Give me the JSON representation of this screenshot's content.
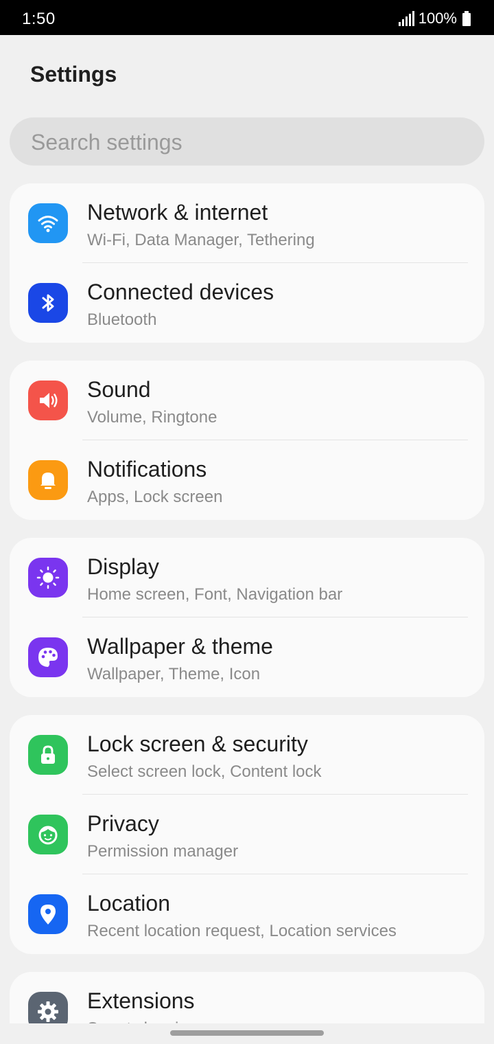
{
  "status_bar": {
    "time": "1:50",
    "battery": "100%"
  },
  "header": {
    "title": "Settings"
  },
  "search": {
    "placeholder": "Search settings"
  },
  "sections": [
    {
      "items": [
        {
          "title": "Network & internet",
          "subtitle": "Wi-Fi, Data Manager, Tethering",
          "icon": "wifi-icon",
          "color": "#2196f3"
        },
        {
          "title": "Connected devices",
          "subtitle": "Bluetooth",
          "icon": "bluetooth-icon",
          "color": "#1a47e6"
        }
      ]
    },
    {
      "items": [
        {
          "title": "Sound",
          "subtitle": "Volume, Ringtone",
          "icon": "speaker-icon",
          "color": "#f4544a"
        },
        {
          "title": "Notifications",
          "subtitle": "Apps, Lock screen",
          "icon": "bell-icon",
          "color": "#fb9a12"
        }
      ]
    },
    {
      "items": [
        {
          "title": "Display",
          "subtitle": "Home screen, Font, Navigation bar",
          "icon": "sun-icon",
          "color": "#7a35ef"
        },
        {
          "title": "Wallpaper & theme",
          "subtitle": "Wallpaper, Theme, Icon",
          "icon": "palette-icon",
          "color": "#7a35ef"
        }
      ]
    },
    {
      "items": [
        {
          "title": "Lock screen & security",
          "subtitle": "Select screen lock, Content lock",
          "icon": "lock-icon",
          "color": "#2fc45c"
        },
        {
          "title": "Privacy",
          "subtitle": "Permission manager",
          "icon": "face-icon",
          "color": "#2fc45c"
        },
        {
          "title": "Location",
          "subtitle": "Recent location request, Location services",
          "icon": "location-pin-icon",
          "color": "#1666f2"
        }
      ]
    },
    {
      "items": [
        {
          "title": "Extensions",
          "subtitle": "Smart sleeping",
          "icon": "gear-icon",
          "color": "#5b6572"
        }
      ]
    }
  ]
}
